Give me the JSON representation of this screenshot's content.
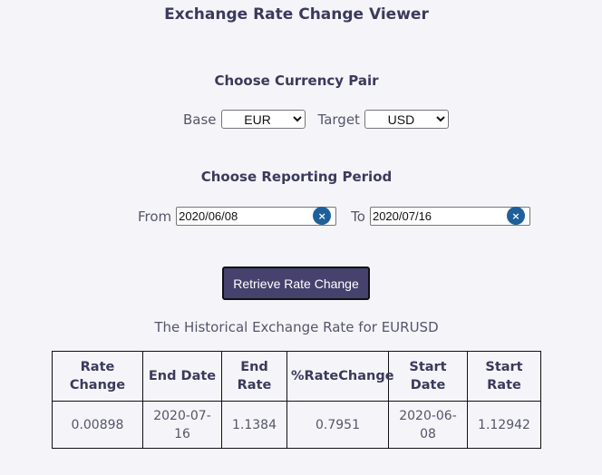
{
  "header": {
    "title": "Exchange Rate Change Viewer"
  },
  "currency": {
    "heading": "Choose Currency Pair",
    "base_label": "Base",
    "base_value": "EUR",
    "target_label": "Target",
    "target_value": "USD"
  },
  "period": {
    "heading": "Choose Reporting Period",
    "from_label": "From",
    "from_value": "2020/06/08",
    "to_label": "To",
    "to_value": "2020/07/16",
    "clear_glyph": "×"
  },
  "action": {
    "retrieve_label": "Retrieve Rate Change"
  },
  "results": {
    "title": "The Historical Exchange Rate for EURUSD",
    "columns": [
      "Rate Change",
      "End Date",
      "End Rate",
      "%RateChange",
      "Start Date",
      "Start Rate"
    ],
    "row": [
      "0.00898",
      "2020-07-16",
      "1.1384",
      "0.7951",
      "2020-06-08",
      "1.12942"
    ]
  },
  "icons": {
    "clear": "clear-icon"
  },
  "colors": {
    "accent": "#45426d",
    "clear_button": "#1f5f9a",
    "heading": "#3b3a5c"
  }
}
